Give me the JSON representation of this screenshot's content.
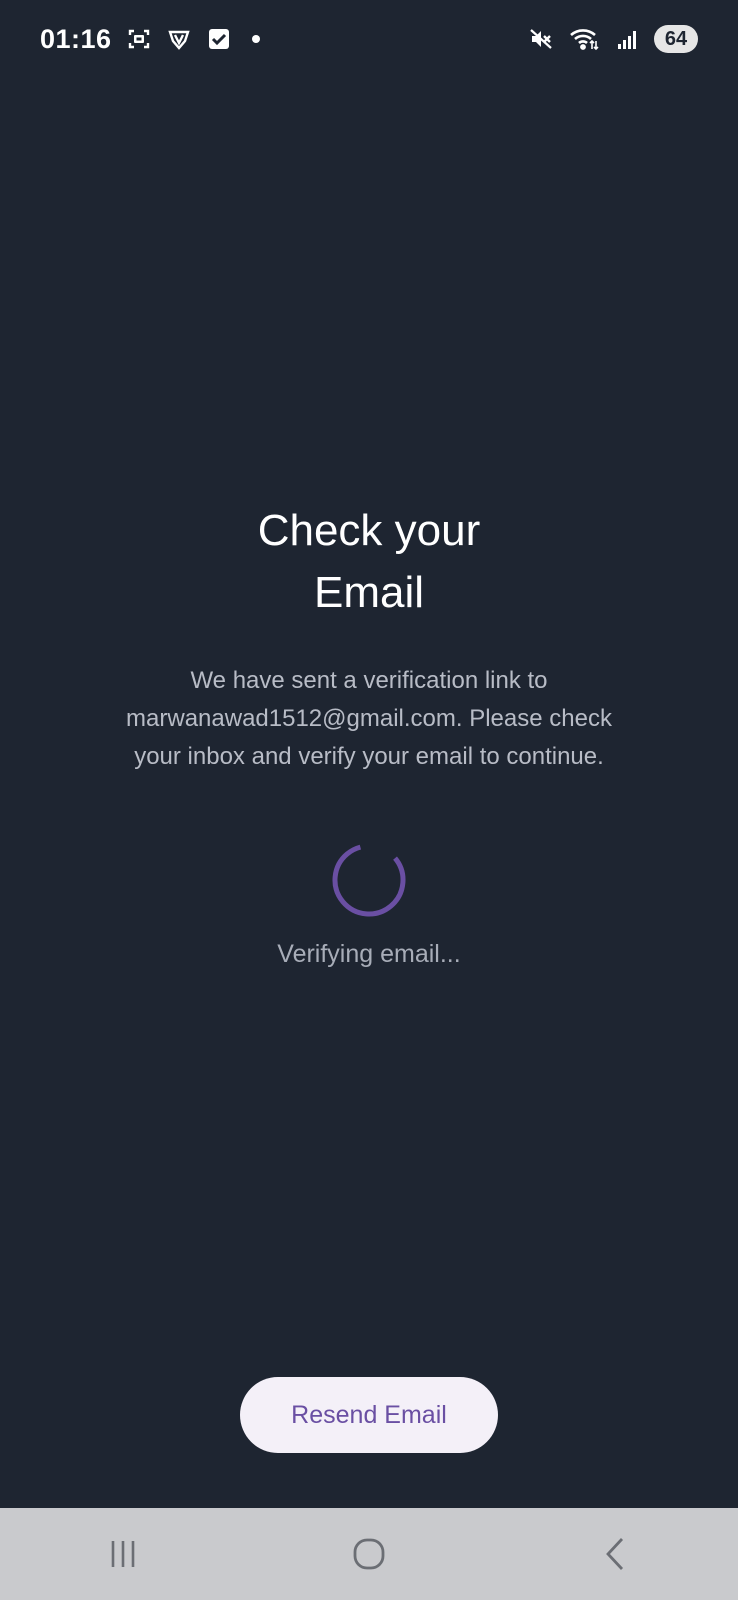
{
  "status_bar": {
    "time": "01:16",
    "battery_level": "64",
    "icons_left": [
      "screenshot-icon",
      "vpn-shield-icon",
      "checkbox-icon",
      "notification-dot"
    ],
    "icons_right": [
      "mute-icon",
      "wifi-icon",
      "signal-icon",
      "battery-icon"
    ]
  },
  "verification": {
    "title_line1": "Check your",
    "title_line2": "Email",
    "message_line1": "We have sent a verification link to",
    "message_line2": "marwanawad1512@gmail.com. Please check",
    "message_line3": "your inbox and verify your email to continue.",
    "status_text": "Verifying email..."
  },
  "actions": {
    "resend_label": "Resend Email"
  },
  "nav_bar": {
    "buttons": [
      "recent-apps-icon",
      "home-icon",
      "back-icon"
    ]
  },
  "colors": {
    "background": "#1e2531",
    "accent": "#6a4fa3",
    "button_bg": "#f4f0f8",
    "nav_bg": "#c9cacd"
  }
}
